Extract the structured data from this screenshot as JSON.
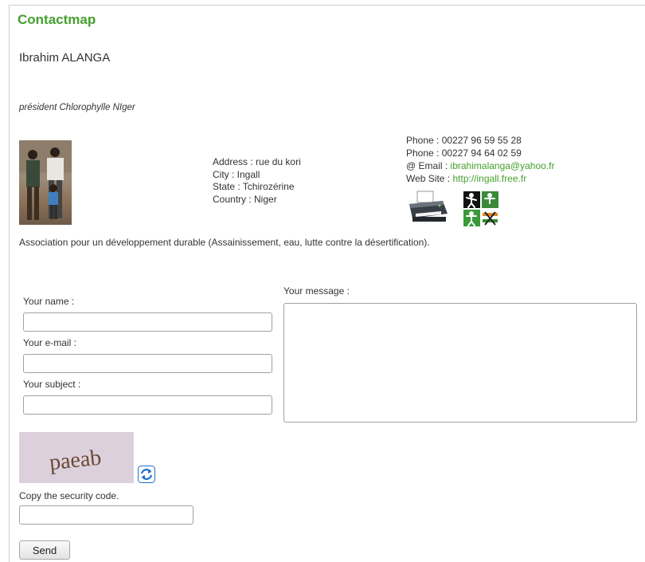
{
  "header": {
    "title": "Contactmap"
  },
  "person": {
    "name": "Ibrahim ALANGA",
    "role": "président Chlorophylle NIger",
    "description": "Association pour un développement durable (Assainissement, eau, lutte contre la désertification)."
  },
  "address": {
    "address_label": "Address :",
    "address_value": "rue du kori",
    "city_line": "City : Ingall",
    "state_line": "State : Tchirozérine",
    "country_line": "Country : Niger"
  },
  "contact": {
    "phone1": "Phone : 00227 96 59 55 28",
    "phone2": "Phone : 00227 94 64 02 59",
    "email_label": "@ Email :",
    "email_value": "ibrahimalanga@yahoo.fr",
    "web_label": "Web Site :",
    "web_value": "http://ingall.free.fr"
  },
  "form": {
    "name_label": "Your name :",
    "email_label": "Your e-mail :",
    "subject_label": "Your subject :",
    "message_label": "Your message :",
    "name_value": "",
    "email_value": "",
    "subject_value": "",
    "message_value": "",
    "captcha_text": "paeab",
    "security_label": "Copy the security code.",
    "security_value": "",
    "send_label": "Send"
  },
  "icons": {
    "printer": "printer-icon",
    "social": "social-network-icon",
    "refresh": "refresh-icon"
  },
  "colors": {
    "accent": "#44a02c",
    "captcha_bg": "#dcd0dc",
    "refresh_blue": "#1e6fd0"
  }
}
